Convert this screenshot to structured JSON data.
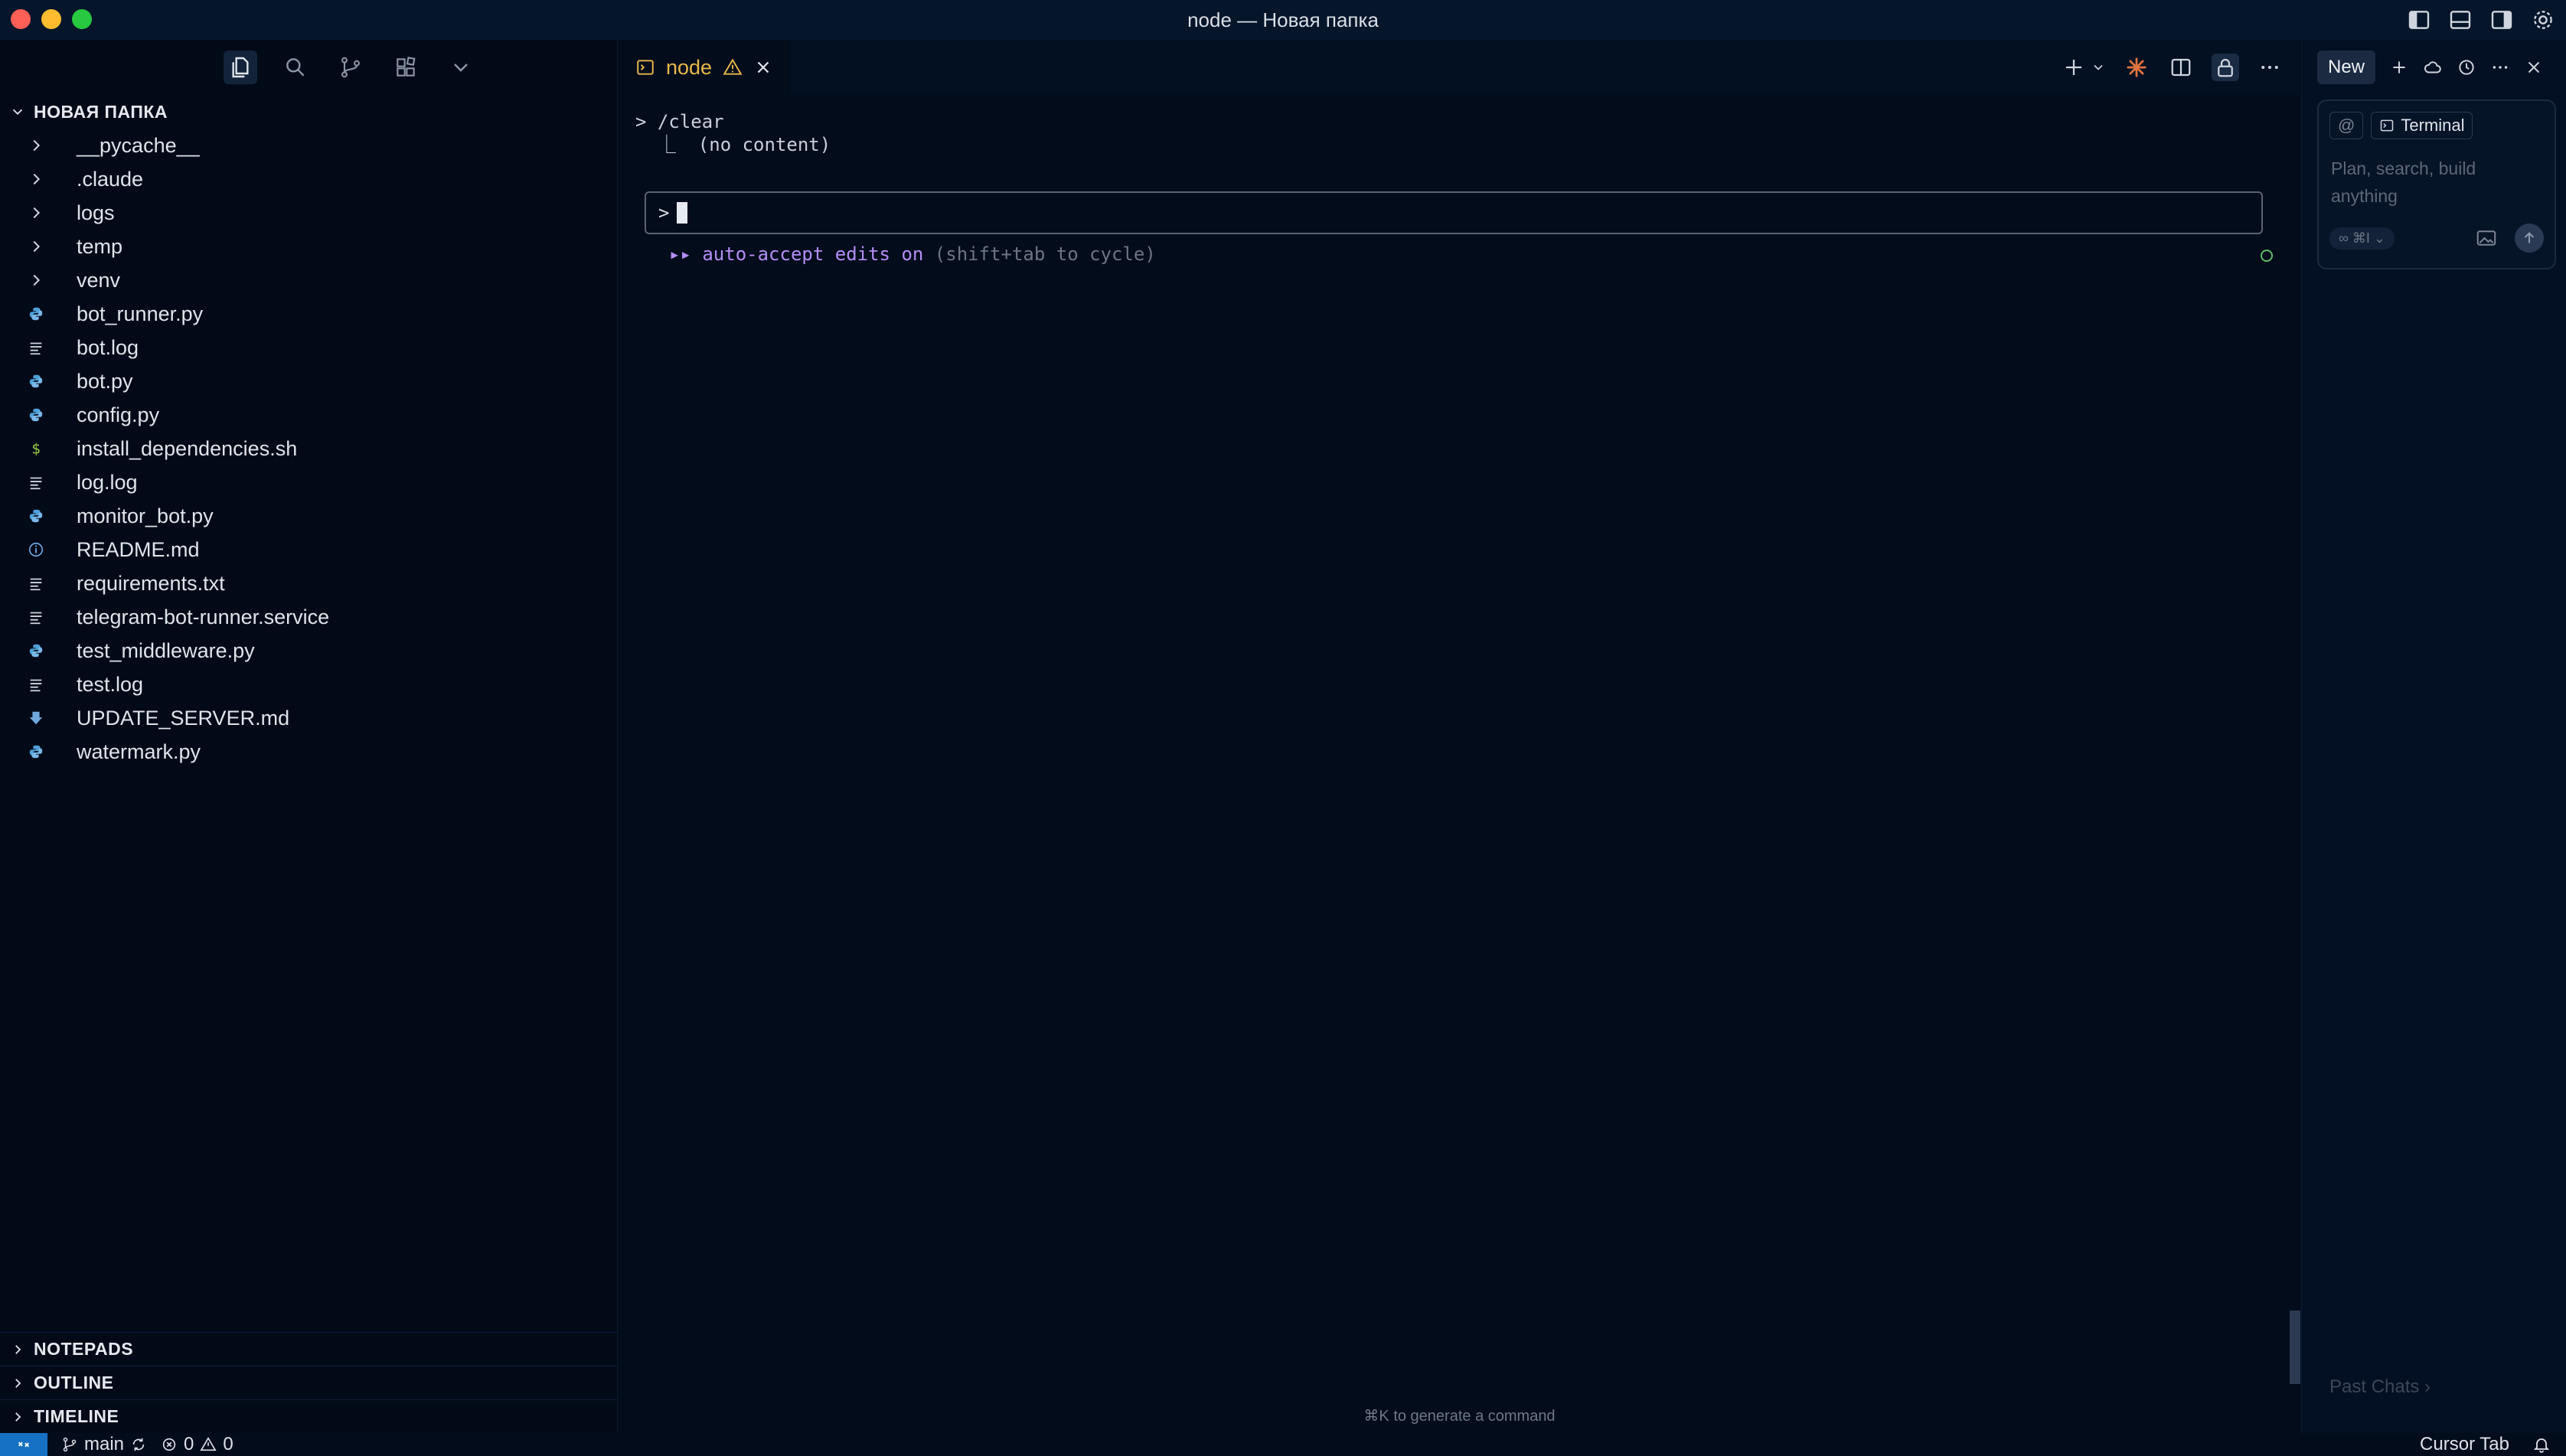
{
  "window": {
    "title": "node — Новая папка"
  },
  "explorer": {
    "folder_name": "НОВАЯ ПАПКА",
    "items": [
      {
        "label": "__pycache__",
        "type": "folder"
      },
      {
        "label": ".claude",
        "type": "folder"
      },
      {
        "label": "logs",
        "type": "folder"
      },
      {
        "label": "temp",
        "type": "folder"
      },
      {
        "label": "venv",
        "type": "folder"
      },
      {
        "label": "bot_runner.py",
        "type": "python"
      },
      {
        "label": "bot.log",
        "type": "text"
      },
      {
        "label": "bot.py",
        "type": "python"
      },
      {
        "label": "config.py",
        "type": "python"
      },
      {
        "label": "install_dependencies.sh",
        "type": "shell"
      },
      {
        "label": "log.log",
        "type": "text"
      },
      {
        "label": "monitor_bot.py",
        "type": "python"
      },
      {
        "label": "README.md",
        "type": "info"
      },
      {
        "label": "requirements.txt",
        "type": "text"
      },
      {
        "label": "telegram-bot-runner.service",
        "type": "text"
      },
      {
        "label": "test_middleware.py",
        "type": "python"
      },
      {
        "label": "test.log",
        "type": "text"
      },
      {
        "label": "UPDATE_SERVER.md",
        "type": "markdown-down"
      },
      {
        "label": "watermark.py",
        "type": "python"
      }
    ],
    "sections": [
      "NOTEPADS",
      "OUTLINE",
      "TIMELINE"
    ]
  },
  "editor": {
    "tab_label": "node",
    "terminal": {
      "line1": "> /clear",
      "line2": "  ⎿  (no content)",
      "prompt": ">",
      "hint_arrows": "▸▸",
      "hint_main": "auto-accept edits on",
      "hint_sub": "(shift+tab to cycle)"
    },
    "footer_hint": "⌘K to generate a command"
  },
  "chat_panel": {
    "new_label": "New",
    "context_at": "@",
    "context_chip": "Terminal",
    "placeholder": "Plan, search, build anything",
    "mode": "∞ ⌘I ⌄",
    "past_chats": "Past Chats ›"
  },
  "statusbar": {
    "branch": "main",
    "errors": "0",
    "warnings": "0",
    "right_label": "Cursor Tab"
  },
  "colors": {
    "accent_blue": "#1670c4",
    "tab_warning": "#e8b84a",
    "hint_purple": "#b48ef5",
    "python_icon": "#4f9fd8",
    "shell_icon": "#9bd14a"
  }
}
